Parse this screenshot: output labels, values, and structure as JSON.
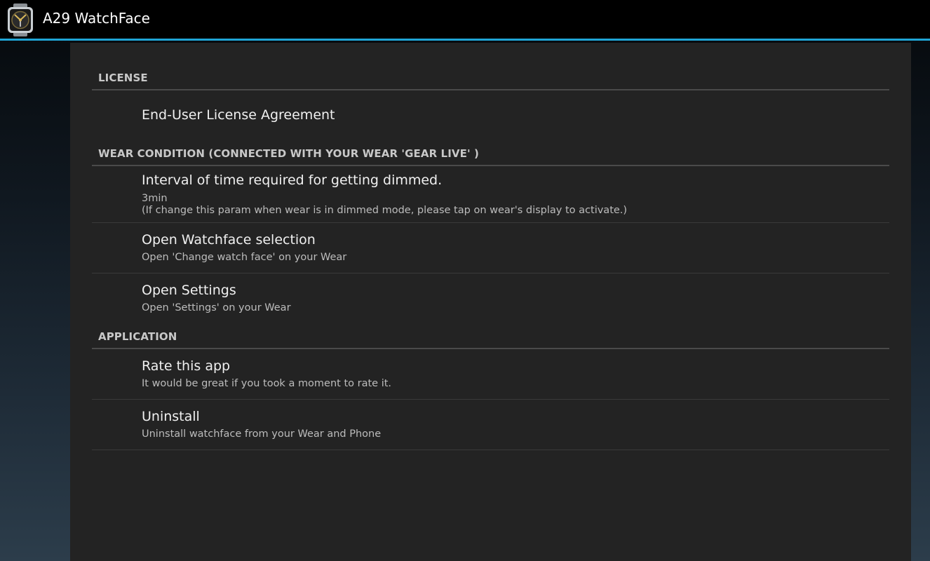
{
  "app": {
    "title": "A29 WatchFace",
    "icon": "watch-app-icon"
  },
  "colors": {
    "action_bar": "#000000",
    "accent_line": "#1fa5d6",
    "panel": "#232323",
    "category_text": "#c8c8c8"
  },
  "categories": {
    "license": "LICENSE",
    "wear_condition": "WEAR CONDITION (CONNECTED WITH YOUR WEAR 'GEAR LIVE' )",
    "application": "APPLICATION"
  },
  "prefs": {
    "eula": {
      "title": "End-User License Agreement"
    },
    "dim_interval": {
      "title": "Interval of time required for getting dimmed.",
      "value": "3min",
      "note": "(If change this param when wear is in dimmed mode, please tap on wear's display to activate.)"
    },
    "watchface_selection": {
      "title": "Open Watchface selection",
      "summary": "Open 'Change watch face' on your Wear"
    },
    "settings": {
      "title": "Open Settings",
      "summary": "Open 'Settings' on your Wear"
    },
    "rate": {
      "title": "Rate this app",
      "summary": "It would be great if you took a moment to rate it."
    },
    "uninstall": {
      "title": "Uninstall",
      "summary": "Uninstall watchface from your Wear and Phone"
    }
  }
}
